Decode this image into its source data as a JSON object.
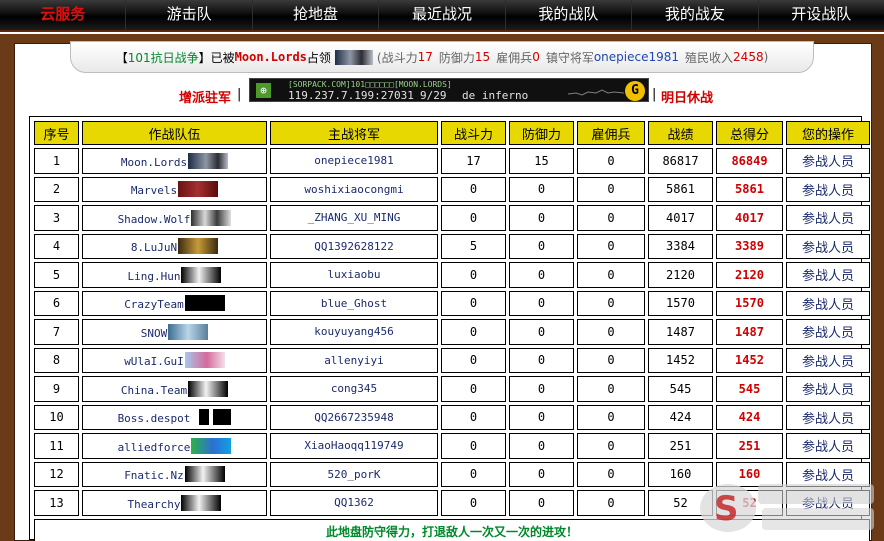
{
  "nav": [
    {
      "label": "云服务",
      "active": true
    },
    {
      "label": "游击队",
      "active": false
    },
    {
      "label": "抢地盘",
      "active": false
    },
    {
      "label": "最近战况",
      "active": false
    },
    {
      "label": "我的战队",
      "active": false
    },
    {
      "label": "我的战友",
      "active": false
    },
    {
      "label": "开设战队",
      "active": false
    }
  ],
  "banner": {
    "bracket_open": "【",
    "battle_name": "101抗日战争",
    "bracket_close": "】已被",
    "occupier": "Moon.Lords",
    "occupied": "占领",
    "power_label": "(战斗力",
    "power_value": "17",
    "defense_label": "防御力",
    "defense_value": "15",
    "merc_label": "雇佣兵",
    "merc_value": "0",
    "general_label": "镇守将军",
    "general_name": "onepiece1981",
    "income_label": "殖民收入",
    "income_value": "2458",
    "close_paren": ")"
  },
  "actions": {
    "reinforce_label": "增派驻军",
    "tomorrow_label": "明日休战",
    "separator": "|"
  },
  "server": {
    "name": "[SORPACK.COM]101□□□□□□[MOON.LORDS]",
    "address": "119.237.7.199:27031",
    "players": "9/29",
    "map": "de_inferno",
    "icon": "cs-icon",
    "go_icon": "go-icon"
  },
  "table": {
    "headers": [
      "序号",
      "作战队伍",
      "主战将军",
      "战斗力",
      "防御力",
      "雇佣兵",
      "战绩",
      "总得分",
      "您的操作"
    ],
    "rows": [
      {
        "rank": "1",
        "team": "Moon.Lords",
        "general": "onepiece1981",
        "power": "17",
        "defense": "15",
        "merc": "0",
        "record": "86817",
        "total": "86849",
        "action": "参战人员"
      },
      {
        "rank": "2",
        "team": "Marvels",
        "general": "woshixiaocongmi",
        "power": "0",
        "defense": "0",
        "merc": "0",
        "record": "5861",
        "total": "5861",
        "action": "参战人员"
      },
      {
        "rank": "3",
        "team": "Shadow.Wolf",
        "general": "_ZHANG_XU_MING",
        "power": "0",
        "defense": "0",
        "merc": "0",
        "record": "4017",
        "total": "4017",
        "action": "参战人员"
      },
      {
        "rank": "4",
        "team": "8.LuJuN",
        "general": "QQ1392628122",
        "power": "5",
        "defense": "0",
        "merc": "0",
        "record": "3384",
        "total": "3389",
        "action": "参战人员"
      },
      {
        "rank": "5",
        "team": "Ling.Hun",
        "general": "luxiaobu",
        "power": "0",
        "defense": "0",
        "merc": "0",
        "record": "2120",
        "total": "2120",
        "action": "参战人员"
      },
      {
        "rank": "6",
        "team": "CrazyTeam",
        "general": "blue_Ghost",
        "power": "0",
        "defense": "0",
        "merc": "0",
        "record": "1570",
        "total": "1570",
        "action": "参战人员"
      },
      {
        "rank": "7",
        "team": "SNOW",
        "general": "kouyuyang456",
        "power": "0",
        "defense": "0",
        "merc": "0",
        "record": "1487",
        "total": "1487",
        "action": "参战人员"
      },
      {
        "rank": "8",
        "team": "wUlaI.GuI",
        "general": "allenyiyi",
        "power": "0",
        "defense": "0",
        "merc": "0",
        "record": "1452",
        "total": "1452",
        "action": "参战人员"
      },
      {
        "rank": "9",
        "team": "China.Team",
        "general": "cong345",
        "power": "0",
        "defense": "0",
        "merc": "0",
        "record": "545",
        "total": "545",
        "action": "参战人员"
      },
      {
        "rank": "10",
        "team": "Boss.despot",
        "general": "QQ2667235948",
        "power": "0",
        "defense": "0",
        "merc": "0",
        "record": "424",
        "total": "424",
        "action": "参战人员"
      },
      {
        "rank": "11",
        "team": "alliedforce",
        "general": "XiaoHaoqq119749",
        "power": "0",
        "defense": "0",
        "merc": "0",
        "record": "251",
        "total": "251",
        "action": "参战人员"
      },
      {
        "rank": "12",
        "team": "Fnatic.Nz",
        "general": "520_porK",
        "power": "0",
        "defense": "0",
        "merc": "0",
        "record": "160",
        "total": "160",
        "action": "参战人员"
      },
      {
        "rank": "13",
        "team": "Thearchy",
        "general": "QQ1362",
        "power": "0",
        "defense": "0",
        "merc": "0",
        "record": "52",
        "total": "52",
        "action": "参战人员"
      }
    ],
    "footer": "此地盘防守得力，打退敌人一次又一次的进攻！"
  },
  "colors": {
    "header_bg": "#e6d800",
    "accent_red": "#d10000",
    "footer_green": "#00882a",
    "frame_brown": "#6b3a17"
  }
}
